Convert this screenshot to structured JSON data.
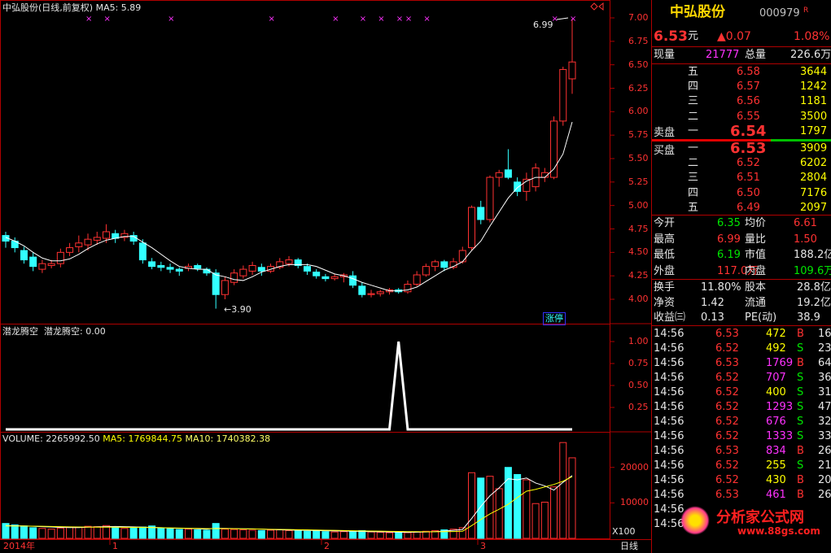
{
  "main_chart": {
    "title": "中弘股份(日线,前复权)",
    "ma5_label": "MA5: 5.89",
    "high_annotation": "6.99",
    "low_annotation": "3.90",
    "limit_up_badge": "涨停",
    "price_axis": [
      "7.00",
      "6.75",
      "6.50",
      "6.25",
      "6.00",
      "5.75",
      "5.50",
      "5.25",
      "5.00",
      "4.75",
      "4.50",
      "4.25",
      "4.00"
    ]
  },
  "indicator": {
    "title": "潜龙腾空",
    "value_label": "潜龙腾空: 0.00",
    "axis": [
      "1.00",
      "0.75",
      "0.50",
      "0.25"
    ]
  },
  "volume": {
    "label": "VOLUME: 2265992.50",
    "ma5_label": "MA5: 1769844.75",
    "ma10_label": "MA10: 1740382.38",
    "axis": [
      "20000",
      "10000"
    ],
    "unit": "X100"
  },
  "time_axis": {
    "year_label": "2014年",
    "months": [
      "1",
      "2",
      "3"
    ],
    "period": "日线"
  },
  "quote": {
    "name": "中弘股份",
    "code": "000979",
    "price": "6.53",
    "price_unit": "元",
    "change": "▲0.07",
    "change_pct": "1.08%",
    "current_vol_label": "现量",
    "current_vol": "21777",
    "total_vol_label": "总量",
    "total_vol": "226.6万",
    "sell_label": "卖盘",
    "buy_label": "买盘",
    "asks": [
      {
        "level": "五",
        "price": "6.58",
        "vol": "3644"
      },
      {
        "level": "四",
        "price": "6.57",
        "vol": "1242"
      },
      {
        "level": "三",
        "price": "6.56",
        "vol": "1181"
      },
      {
        "level": "二",
        "price": "6.55",
        "vol": "3500"
      },
      {
        "level": "一",
        "price": "6.54",
        "vol": "1797"
      }
    ],
    "bids": [
      {
        "level": "一",
        "price": "6.53",
        "vol": "3909"
      },
      {
        "level": "二",
        "price": "6.52",
        "vol": "6202"
      },
      {
        "level": "三",
        "price": "6.51",
        "vol": "2804"
      },
      {
        "level": "四",
        "price": "6.50",
        "vol": "7176"
      },
      {
        "level": "五",
        "price": "6.49",
        "vol": "2097"
      }
    ],
    "stats": [
      {
        "k1": "今开",
        "v1": "6.35",
        "k2": "均价",
        "v2": "6.61"
      },
      {
        "k1": "最高",
        "v1": "6.99",
        "k2": "量比",
        "v2": "1.50"
      },
      {
        "k1": "最低",
        "v1": "6.19",
        "k2": "市值",
        "v2": "188.2亿"
      },
      {
        "k1": "外盘",
        "v1": "117.0万",
        "k2": "内盘",
        "v2": "109.6万"
      }
    ],
    "stats2": [
      {
        "k1": "换手",
        "v1": "11.80%",
        "k2": "股本",
        "v2": "28.8亿"
      },
      {
        "k1": "净资",
        "v1": "1.42",
        "k2": "流通",
        "v2": "19.2亿"
      },
      {
        "k1": "收益㈢",
        "v1": "0.13",
        "k2": "PE(动)",
        "v2": "38.9"
      }
    ],
    "ticks": [
      {
        "t": "14:56",
        "p": "6.53",
        "v": "472",
        "s": "B",
        "n": "16"
      },
      {
        "t": "14:56",
        "p": "6.52",
        "v": "492",
        "s": "S",
        "n": "23"
      },
      {
        "t": "14:56",
        "p": "6.53",
        "v": "1769",
        "s": "B",
        "n": "64"
      },
      {
        "t": "14:56",
        "p": "6.52",
        "v": "707",
        "s": "S",
        "n": "36"
      },
      {
        "t": "14:56",
        "p": "6.52",
        "v": "400",
        "s": "S",
        "n": "31"
      },
      {
        "t": "14:56",
        "p": "6.52",
        "v": "1293",
        "s": "S",
        "n": "47"
      },
      {
        "t": "14:56",
        "p": "6.52",
        "v": "676",
        "s": "S",
        "n": "32"
      },
      {
        "t": "14:56",
        "p": "6.52",
        "v": "1333",
        "s": "S",
        "n": "33"
      },
      {
        "t": "14:56",
        "p": "6.53",
        "v": "834",
        "s": "B",
        "n": "26"
      },
      {
        "t": "14:56",
        "p": "6.52",
        "v": "255",
        "s": "S",
        "n": "21"
      },
      {
        "t": "14:56",
        "p": "6.52",
        "v": "430",
        "s": "B",
        "n": "20"
      },
      {
        "t": "14:56",
        "p": "6.53",
        "v": "461",
        "s": "B",
        "n": "26"
      },
      {
        "t": "14:56",
        "p": "",
        "v": "",
        "s": "",
        "n": ""
      },
      {
        "t": "14:56",
        "p": "",
        "v": "",
        "s": "",
        "n": ""
      }
    ],
    "watermark_text": "分析家公式网",
    "watermark_url": "www.88gs.com"
  },
  "chart_data": {
    "type": "candlestick",
    "ylim": [
      3.85,
      7.1
    ],
    "candles": [
      [
        4.68,
        4.62,
        4.72,
        4.55
      ],
      [
        4.62,
        4.55,
        4.66,
        4.5
      ],
      [
        4.52,
        4.42,
        4.56,
        4.38
      ],
      [
        4.45,
        4.35,
        4.5,
        4.3
      ],
      [
        4.32,
        4.38,
        4.42,
        4.28
      ],
      [
        4.36,
        4.38,
        4.42,
        4.33
      ],
      [
        4.38,
        4.5,
        4.54,
        4.34
      ],
      [
        4.5,
        4.55,
        4.6,
        4.46
      ],
      [
        4.56,
        4.6,
        4.68,
        4.5
      ],
      [
        4.58,
        4.64,
        4.7,
        4.52
      ],
      [
        4.63,
        4.66,
        4.72,
        4.58
      ],
      [
        4.65,
        4.72,
        4.8,
        4.6
      ],
      [
        4.7,
        4.65,
        4.74,
        4.6
      ],
      [
        4.66,
        4.7,
        4.74,
        4.62
      ],
      [
        4.68,
        4.62,
        4.72,
        4.58
      ],
      [
        4.6,
        4.42,
        4.64,
        4.38
      ],
      [
        4.4,
        4.35,
        4.44,
        4.32
      ],
      [
        4.36,
        4.34,
        4.4,
        4.3
      ],
      [
        4.34,
        4.32,
        4.38,
        4.28
      ],
      [
        4.32,
        4.3,
        4.34,
        4.25
      ],
      [
        4.33,
        4.35,
        4.38,
        4.3
      ],
      [
        4.36,
        4.33,
        4.38,
        4.3
      ],
      [
        4.32,
        4.28,
        4.34,
        4.25
      ],
      [
        4.28,
        4.05,
        4.32,
        3.9
      ],
      [
        4.05,
        4.2,
        4.24,
        4.0
      ],
      [
        4.18,
        4.28,
        4.32,
        4.15
      ],
      [
        4.25,
        4.32,
        4.36,
        4.22
      ],
      [
        4.3,
        4.36,
        4.4,
        4.26
      ],
      [
        4.34,
        4.3,
        4.38,
        4.25
      ],
      [
        4.3,
        4.35,
        4.38,
        4.28
      ],
      [
        4.34,
        4.4,
        4.44,
        4.32
      ],
      [
        4.38,
        4.42,
        4.46,
        4.35
      ],
      [
        4.42,
        4.36,
        4.44,
        4.33
      ],
      [
        4.35,
        4.3,
        4.38,
        4.26
      ],
      [
        4.29,
        4.25,
        4.32,
        4.22
      ],
      [
        4.24,
        4.22,
        4.27,
        4.19
      ],
      [
        4.22,
        4.24,
        4.27,
        4.2
      ],
      [
        4.24,
        4.26,
        4.28,
        4.18
      ],
      [
        4.25,
        4.15,
        4.3,
        4.12
      ],
      [
        4.14,
        4.05,
        4.18,
        4.02
      ],
      [
        4.05,
        4.06,
        4.1,
        4.02
      ],
      [
        4.06,
        4.08,
        4.1,
        4.03
      ],
      [
        4.08,
        4.1,
        4.12,
        4.05
      ],
      [
        4.1,
        4.08,
        4.12,
        4.06
      ],
      [
        4.08,
        4.16,
        4.2,
        4.06
      ],
      [
        4.16,
        4.26,
        4.3,
        4.14
      ],
      [
        4.26,
        4.35,
        4.38,
        4.24
      ],
      [
        4.35,
        4.4,
        4.42,
        4.3
      ],
      [
        4.4,
        4.34,
        4.42,
        4.3
      ],
      [
        4.34,
        4.4,
        4.44,
        4.32
      ],
      [
        4.4,
        4.52,
        4.56,
        4.38
      ],
      [
        4.55,
        4.98,
        5.0,
        4.52
      ],
      [
        4.98,
        4.85,
        5.05,
        4.8
      ],
      [
        4.85,
        5.3,
        5.32,
        4.82
      ],
      [
        5.3,
        5.35,
        5.38,
        5.2
      ],
      [
        5.38,
        5.3,
        5.6,
        5.28
      ],
      [
        5.25,
        5.15,
        5.3,
        5.1
      ],
      [
        5.15,
        5.28,
        5.35,
        5.05
      ],
      [
        5.2,
        5.4,
        5.45,
        5.15
      ],
      [
        5.3,
        5.35,
        5.4,
        5.25
      ],
      [
        5.3,
        5.9,
        5.95,
        5.28
      ],
      [
        5.9,
        6.45,
        6.48,
        5.85
      ],
      [
        6.35,
        6.53,
        6.99,
        6.19
      ]
    ],
    "ma5": [
      4.66,
      4.62,
      4.57,
      4.5,
      4.44,
      4.41,
      4.41,
      4.43,
      4.48,
      4.54,
      4.59,
      4.63,
      4.65,
      4.67,
      4.67,
      4.61,
      4.55,
      4.48,
      4.41,
      4.35,
      4.33,
      4.32,
      4.32,
      4.26,
      4.24,
      4.21,
      4.2,
      4.24,
      4.29,
      4.32,
      4.35,
      4.37,
      4.37,
      4.37,
      4.35,
      4.31,
      4.27,
      4.25,
      4.22,
      4.18,
      4.15,
      4.12,
      4.09,
      4.09,
      4.1,
      4.13,
      4.19,
      4.25,
      4.31,
      4.35,
      4.4,
      4.52,
      4.62,
      4.78,
      4.93,
      5.08,
      5.19,
      5.26,
      5.3,
      5.3,
      5.39,
      5.55,
      5.89
    ],
    "indicator_values": [
      0,
      0,
      0,
      0,
      0,
      0,
      0,
      0,
      0,
      0,
      0,
      0,
      0,
      0,
      0,
      0,
      0,
      0,
      0,
      0,
      0,
      0,
      0,
      0,
      0,
      0,
      0,
      0,
      0,
      0,
      0,
      0,
      0,
      0,
      0,
      0,
      0,
      0,
      0,
      0,
      0,
      0,
      0,
      0,
      0,
      0,
      0,
      0,
      0,
      0,
      0,
      0,
      0,
      0,
      0,
      0,
      0,
      0,
      0,
      0,
      0,
      0,
      0
    ],
    "indicator_spike_index": 43,
    "volumes": [
      4200,
      3800,
      3500,
      3000,
      2800,
      2600,
      2900,
      3200,
      3100,
      3400,
      3300,
      3600,
      3100,
      2800,
      3000,
      3200,
      3500,
      2900,
      2700,
      2500,
      2600,
      2400,
      2300,
      4200,
      2600,
      2500,
      2400,
      2300,
      2200,
      2300,
      2400,
      2200,
      2100,
      2000,
      2100,
      1900,
      1800,
      1900,
      2000,
      2200,
      1800,
      1700,
      1600,
      1700,
      1600,
      1800,
      2000,
      2200,
      2400,
      2600,
      3000,
      18500,
      17000,
      17500,
      14000,
      20000,
      18000,
      16500,
      9800,
      10200,
      14500,
      27000,
      22700
    ],
    "volume_ma5": [
      3600,
      3550,
      3500,
      3400,
      3300,
      3200,
      3100,
      3050,
      3050,
      3150,
      3250,
      3300,
      3350,
      3300,
      3250,
      3150,
      3100,
      3000,
      2900,
      2850,
      2800,
      2700,
      2600,
      2850,
      2800,
      2750,
      2700,
      2650,
      2600,
      2500,
      2400,
      2350,
      2300,
      2250,
      2200,
      2150,
      2100,
      2050,
      2000,
      1950,
      1900,
      1850,
      1800,
      1750,
      1700,
      1750,
      1800,
      1900,
      2050,
      2250,
      2500,
      5600,
      9000,
      12000,
      14200,
      16800,
      16500,
      17000,
      15600,
      14800,
      13600,
      15800,
      17700
    ],
    "volume_ma10": [
      3500,
      3500,
      3480,
      3450,
      3400,
      3350,
      3300,
      3250,
      3200,
      3180,
      3160,
      3150,
      3140,
      3120,
      3100,
      3080,
      3050,
      3000,
      2950,
      2900,
      2850,
      2800,
      2750,
      2760,
      2750,
      2720,
      2700,
      2650,
      2600,
      2560,
      2520,
      2480,
      2440,
      2400,
      2350,
      2300,
      2250,
      2200,
      2150,
      2100,
      2060,
      2020,
      1980,
      1940,
      1900,
      1880,
      1860,
      1860,
      1880,
      1920,
      2000,
      3600,
      5300,
      6900,
      8200,
      9600,
      11500,
      13300,
      13800,
      14500,
      15200,
      16100,
      17400
    ],
    "marker_indices": [
      9,
      11,
      18,
      29,
      36,
      39,
      41,
      43,
      44,
      46,
      60,
      62
    ]
  }
}
